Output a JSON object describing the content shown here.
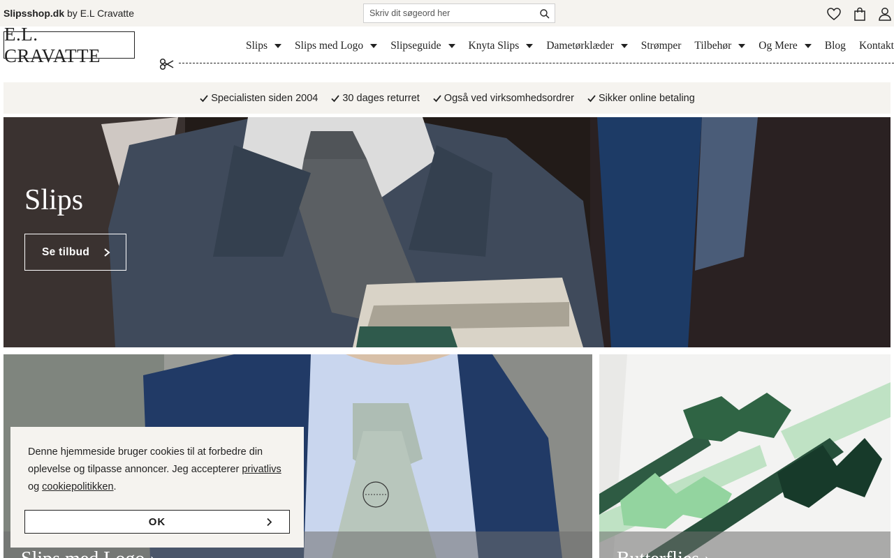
{
  "topbar": {
    "brand_bold": "Slipsshop.dk",
    "brand_rest": " by E.L Cravatte",
    "search_placeholder": "Skriv dit søgeord her"
  },
  "header": {
    "logo": "E.L. CRAVATTE",
    "nav": [
      {
        "label": "Slips",
        "dropdown": true
      },
      {
        "label": "Slips med Logo",
        "dropdown": true
      },
      {
        "label": "Slipseguide",
        "dropdown": true
      },
      {
        "label": "Knyta Slips",
        "dropdown": true
      },
      {
        "label": "Dametørklæder",
        "dropdown": true
      },
      {
        "label": "Strømper",
        "dropdown": false
      },
      {
        "label": "Tilbehør",
        "dropdown": true
      },
      {
        "label": "Og Mere",
        "dropdown": true
      },
      {
        "label": "Blog",
        "dropdown": false
      },
      {
        "label": "Kontakt",
        "dropdown": true
      }
    ]
  },
  "usp": [
    "Specialisten siden 2004",
    "30 dages returret",
    "Også ved virksomhedsordrer",
    "Sikker online betaling"
  ],
  "hero": {
    "title": "Slips",
    "button": "Se tilbud"
  },
  "tiles": {
    "logo_label": "Slips med Logo ›",
    "bow_label": "Butterflies ›"
  },
  "cookie": {
    "text_before": "Denne hjemmeside bruger cookies til at forbedre din oplevelse og tilpasse annoncer. Jeg accepterer ",
    "link_privacy": "privatlivs",
    "text_mid": " og ",
    "link_cookie": "cookiepolitikken",
    "text_end": ".",
    "button": "OK"
  },
  "colors": {
    "topbar_bg": "#f5f3ef",
    "text": "#222222",
    "hero_bg": "#211a17"
  }
}
